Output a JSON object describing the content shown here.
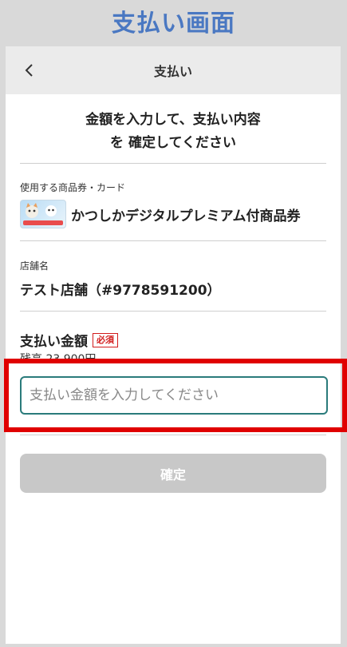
{
  "caption": "支払い画面",
  "nav": {
    "title": "支払い",
    "back_icon": "chevron-left-icon"
  },
  "headline": {
    "line1": "金額を入力して、支払い内容",
    "line2": "を 確定してください"
  },
  "voucher": {
    "label": "使用する商品券・カード",
    "name": "かつしかデジタルプレミアム付商品券"
  },
  "store": {
    "label": "店舗名",
    "name": "テスト店舗（#9778591200）"
  },
  "amount": {
    "label": "支払い金額",
    "required_badge": "必須",
    "balance": "残高 23,900円",
    "placeholder": "支払い金額を入力してください",
    "value": ""
  },
  "confirm_button": "確定",
  "colors": {
    "accent": "#4a78c2",
    "input_border": "#2a7b7b",
    "highlight": "#e00000",
    "required": "#d21b1b"
  }
}
